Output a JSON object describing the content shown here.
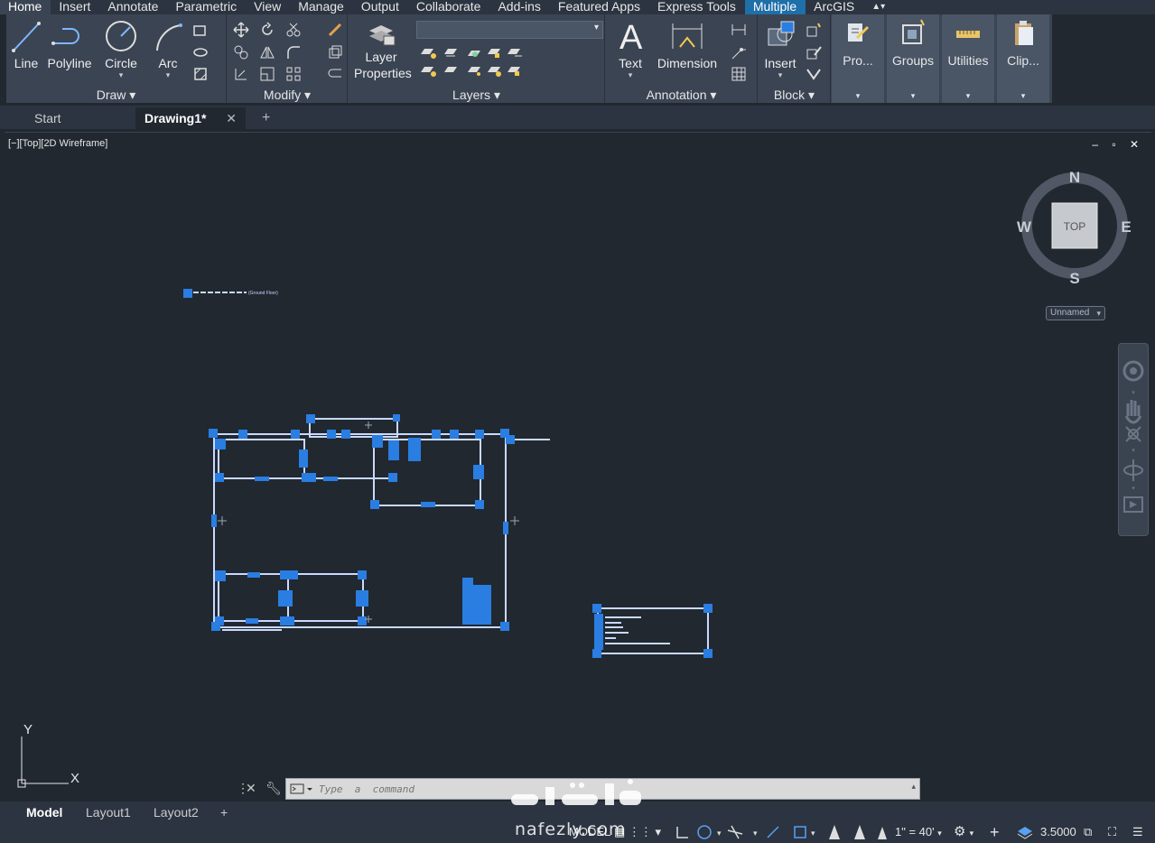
{
  "ribbon_tabs": [
    "Home",
    "Insert",
    "Annotate",
    "Parametric",
    "View",
    "Manage",
    "Output",
    "Collaborate",
    "Add-ins",
    "Featured Apps",
    "Express Tools",
    "Multiple",
    "ArcGIS"
  ],
  "ribbon": {
    "draw": {
      "title": "Draw ▾",
      "line": "Line",
      "polyline": "Polyline",
      "circle": "Circle",
      "arc": "Arc"
    },
    "modify": {
      "title": "Modify ▾"
    },
    "layers": {
      "title": "Layers ▾",
      "layer_properties": "Layer Properties"
    },
    "annotation": {
      "title": "Annotation ▾",
      "text": "Text",
      "dimension": "Dimension"
    },
    "block": {
      "title": "Block ▾",
      "insert": "Insert"
    },
    "side_panels": [
      "Pro...",
      "Groups",
      "Utilities",
      "Clip..."
    ]
  },
  "file_tabs": {
    "start": "Start",
    "drawing": "Drawing1*",
    "close": "✕",
    "add": "+"
  },
  "viewport": {
    "label": "[−][Top][2D Wireframe]",
    "controls": "‒ ▫ ✕",
    "drawing_label": "(Ground Floor)"
  },
  "viewcube": {
    "face": "TOP",
    "north": "N",
    "south": "S",
    "east": "E",
    "west": "W",
    "ucs": "Unnamed"
  },
  "ucs_icon": {
    "y": "Y",
    "x": "X"
  },
  "command": {
    "placeholder": "Type  a  command"
  },
  "layout_tabs": [
    "Model",
    "Layout1",
    "Layout2",
    "+"
  ],
  "status": {
    "model": "MODEL",
    "scale": "1\" = 40'",
    "lineweight": "3.5000"
  },
  "watermark": {
    "text": "nafezly.com"
  },
  "colors": {
    "accent": "#1f6fa8",
    "selection": "#2a7de1",
    "background": "#212830",
    "ribbon": "#3b4453"
  }
}
